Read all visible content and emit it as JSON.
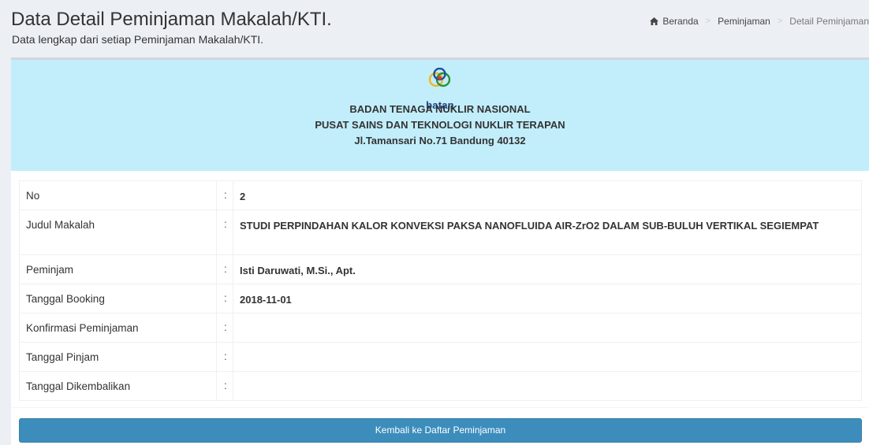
{
  "header": {
    "title": "Data Detail Peminjaman Makalah/KTI.",
    "subtitle": "Data lengkap dari setiap Peminjaman Makalah/KTI."
  },
  "breadcrumb": {
    "home_icon": "home-icon",
    "items": [
      "Beranda",
      "Peminjaman",
      "Detail Peminjaman"
    ],
    "separator": ">"
  },
  "institution": {
    "logo_text": "batan",
    "name": "BADAN TENAGA NUKLIR NASIONAL",
    "center": "PUSAT SAINS DAN TEKNOLOGI NUKLIR TERAPAN",
    "address": "Jl.Tamansari No.71 Bandung 40132",
    "band_color": "#c2eefb"
  },
  "details": {
    "colon": ":",
    "rows": [
      {
        "label": "No",
        "value": "2"
      },
      {
        "label": "Judul Makalah",
        "value": "STUDI PERPINDAHAN KALOR KONVEKSI PAKSA NANOFLUIDA AIR-ZrO2 DALAM SUB-BULUH VERTIKAL SEGIEMPAT"
      },
      {
        "label": "Peminjam",
        "value": "Isti Daruwati, M.Si., Apt."
      },
      {
        "label": "Tanggal Booking",
        "value": "2018-11-01"
      },
      {
        "label": "Konfirmasi Peminjaman",
        "value": ""
      },
      {
        "label": "Tanggal Pinjam",
        "value": ""
      },
      {
        "label": "Tanggal Dikembalikan",
        "value": ""
      }
    ]
  },
  "actions": {
    "back_label": "Kembali ke Daftar Peminjaman",
    "accent": "#3c8dbc"
  }
}
